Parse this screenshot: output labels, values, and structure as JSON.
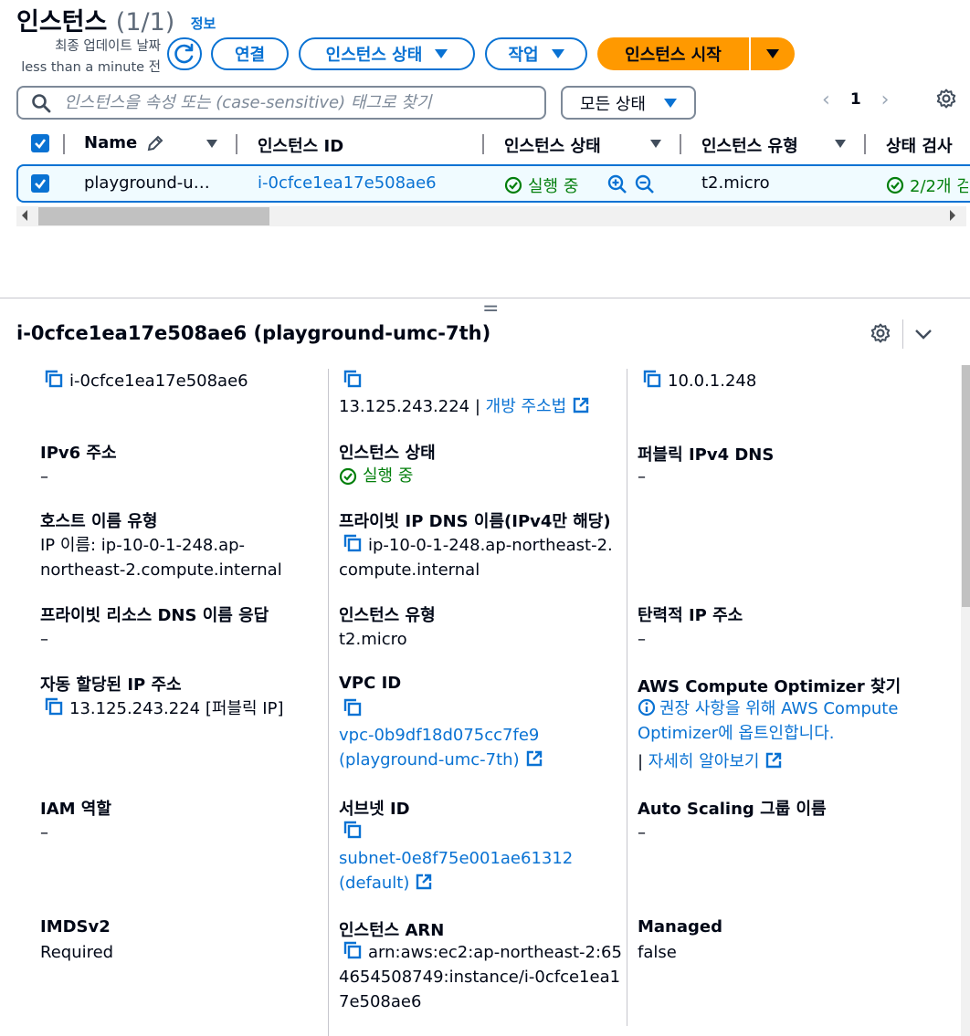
{
  "header": {
    "title": "인스턴스",
    "count": "(1/1)",
    "info_link": "정보",
    "updated_line1": "최종 업데이트 날짜",
    "updated_line2": "less than a minute 전"
  },
  "toolbar": {
    "connect": "연결",
    "instance_state": "인스턴스 상태",
    "actions": "작업",
    "start": "인스턴스 시작"
  },
  "search": {
    "placeholder": "인스턴스을 속성 또는 (case-sensitive) 태그로 찾기"
  },
  "state_filter": "모든 상태",
  "pagination": {
    "page": "1"
  },
  "table": {
    "columns": [
      "Name",
      "인스턴스 ID",
      "인스턴스 상태",
      "인스턴스 유형",
      "상태 검사"
    ],
    "row": {
      "name": "playground-u…",
      "instance_id": "i-0cfce1ea17e508ae6",
      "state": "실행 중",
      "type": "t2.micro",
      "status_check": "2/2개 검"
    }
  },
  "details": {
    "title": "i-0cfce1ea17e508ae6 (playground-umc-7th)",
    "col1": {
      "instance_id": "i-0cfce1ea17e508ae6",
      "ipv6_label": "IPv6 주소",
      "ipv6_value": "–",
      "hostname_type_label": "호스트 이름 유형",
      "hostname_type_value1": "IP 이름: ip-10-0-1-248.ap-",
      "hostname_type_value2": "northeast-2.compute.internal",
      "private_resource_dns_label": "프라이빗 리소스 DNS 이름 응답",
      "private_resource_dns_value": "–",
      "auto_ip_label": "자동 할당된 IP 주소",
      "auto_ip_value": "13.125.243.224 [퍼블릭 IP]",
      "iam_label": "IAM 역할",
      "iam_value": "–",
      "imds_label": "IMDSv2",
      "imds_value": "Required"
    },
    "col2": {
      "public_ip": "13.125.243.224",
      "open_address_link": "개방 주소법",
      "state_label": "인스턴스 상태",
      "state_value": "실행 중",
      "private_ip_dns_label": "프라이빗 IP DNS 이름(IPv4만 해당)",
      "private_ip_dns_value1": "ip-10-0-1-248.ap-northeast-2.",
      "private_ip_dns_value2": "compute.internal",
      "type_label": "인스턴스 유형",
      "type_value": "t2.micro",
      "vpc_label": "VPC ID",
      "vpc_value1": "vpc-0b9df18d075cc7fe9",
      "vpc_value2": "(playground-umc-7th)",
      "subnet_label": "서브넷 ID",
      "subnet_value1": "subnet-0e8f75e001ae61312",
      "subnet_value2": "(default)",
      "arn_label": "인스턴스 ARN",
      "arn_value1": "arn:aws:ec2:ap-northeast-2:65",
      "arn_value2": "4654508749:instance/i-0cfce1ea1",
      "arn_value3": "7e508ae6"
    },
    "col3": {
      "private_ip": "10.0.1.248",
      "public_dns_label": "퍼블릭 IPv4 DNS",
      "public_dns_value": "–",
      "elastic_ip_label": "탄력적 IP 주소",
      "elastic_ip_value": "–",
      "optimizer_label": "AWS Compute Optimizer 찾기",
      "optimizer_text1": "권장 사항을 위해 AWS Compute",
      "optimizer_text2": "Optimizer",
      "optimizer_text3": "에 옵트인합니다.",
      "learn_more": "자세히 알아보기",
      "asg_label": "Auto Scaling 그룹 이름",
      "asg_value": "–",
      "managed_label": "Managed",
      "managed_value": "false"
    }
  },
  "colors": {
    "link": "#0972d3",
    "success": "#037f0c",
    "primary_button": "#ff9900",
    "selected_row_bg": "#f0fbff"
  }
}
